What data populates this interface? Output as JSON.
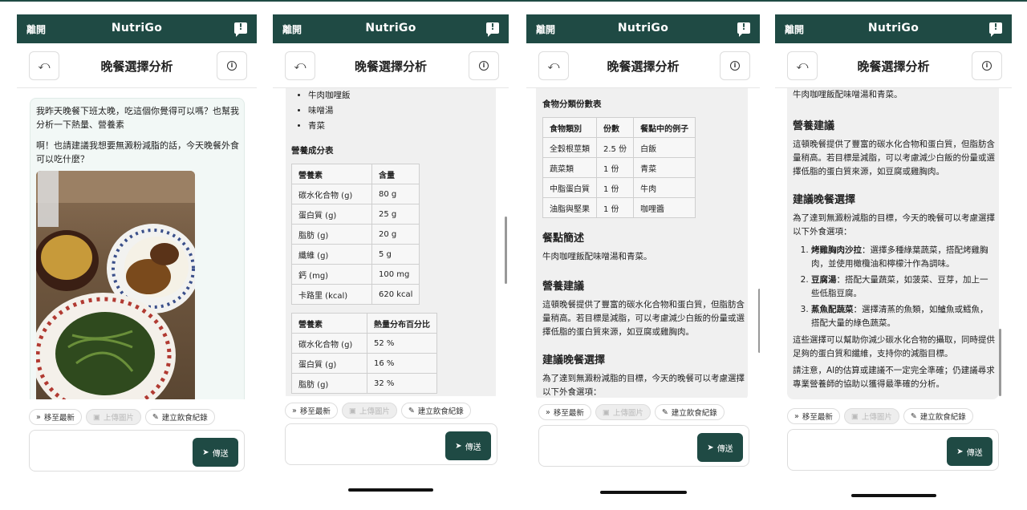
{
  "app": {
    "leave": "離開",
    "brand": "NutriGo",
    "page_title": "晚餐選擇分析"
  },
  "composer": {
    "latest": "移至最新",
    "upload": "上傳圖片",
    "record": "建立飲食紀錄",
    "send": "傳送"
  },
  "user_msg": {
    "p1": "我昨天晚餐下班太晚，吃這個你覺得可以嗎？也幫我分析一下熱量、營養素",
    "p2": "啊！也請建議我想要無澱粉減脂的話，今天晚餐外食可以吃什麼？"
  },
  "meal_items": [
    "牛肉咖哩飯",
    "味噌湯",
    "青菜"
  ],
  "nutrition": {
    "title": "營養成分表",
    "headers": [
      "營養素",
      "含量"
    ],
    "rows": [
      [
        "碳水化合物 (g)",
        "80 g"
      ],
      [
        "蛋白質 (g)",
        "25 g"
      ],
      [
        "脂肪 (g)",
        "20 g"
      ],
      [
        "纖維 (g)",
        "5 g"
      ],
      [
        "鈣 (mg)",
        "100 mg"
      ],
      [
        "卡路里 (kcal)",
        "620 kcal"
      ]
    ]
  },
  "distribution": {
    "headers": [
      "營養素",
      "熱量分布百分比"
    ],
    "rows": [
      [
        "碳水化合物 (g)",
        "52 %"
      ],
      [
        "蛋白質 (g)",
        "16 %"
      ],
      [
        "脂肪 (g)",
        "32 %"
      ]
    ]
  },
  "portions": {
    "title": "食物分類份數表",
    "headers": [
      "食物類別",
      "份數",
      "餐點中的例子"
    ],
    "rows": [
      [
        "全穀根莖類",
        "2.5 份",
        "白飯"
      ],
      [
        "蔬菜類",
        "1 份",
        "青菜"
      ],
      [
        "中脂蛋白質",
        "1 份",
        "牛肉"
      ],
      [
        "油脂與堅果",
        "1 份",
        "咖哩醬"
      ]
    ]
  },
  "summary": {
    "title": "餐點簡述",
    "text": "牛肉咖哩飯配味噌湯和青菜。"
  },
  "advice": {
    "title": "營養建議",
    "text": "這頓晚餐提供了豐富的碳水化合物和蛋白質，但脂肪含量稍高。若目標是減脂，可以考慮減少白飯的份量或選擇低脂的蛋白質來源，如豆腐或雞胸肉。"
  },
  "suggest": {
    "title": "建議晚餐選擇",
    "intro": "為了達到無澱粉減脂的目標，今天的晚餐可以考慮選擇以下外食選項：",
    "items": [
      {
        "name": "烤雞胸肉沙拉",
        "desc": "：選擇多種綠葉蔬菜，搭配烤雞胸肉，並使用橄欖油和檸檬汁作為調味。"
      },
      {
        "name": "豆腐湯",
        "desc": "：搭配大量蔬菜，如菠菜、豆芽，加上一些低脂豆腐。"
      },
      {
        "name": "蒸魚配蔬菜",
        "desc": "：選擇清蒸的魚類，如鱸魚或鱈魚，搭配大量的綠色蔬菜。"
      }
    ],
    "closing1": "這些選擇可以幫助你減少碳水化合物的攝取，同時提供足夠的蛋白質和纖維，支持你的減脂目標。",
    "closing2": "請注意，AI的估算或建議不一定完全準確；仍建議尋求專業營養師的協助以獲得最準確的分析。"
  }
}
